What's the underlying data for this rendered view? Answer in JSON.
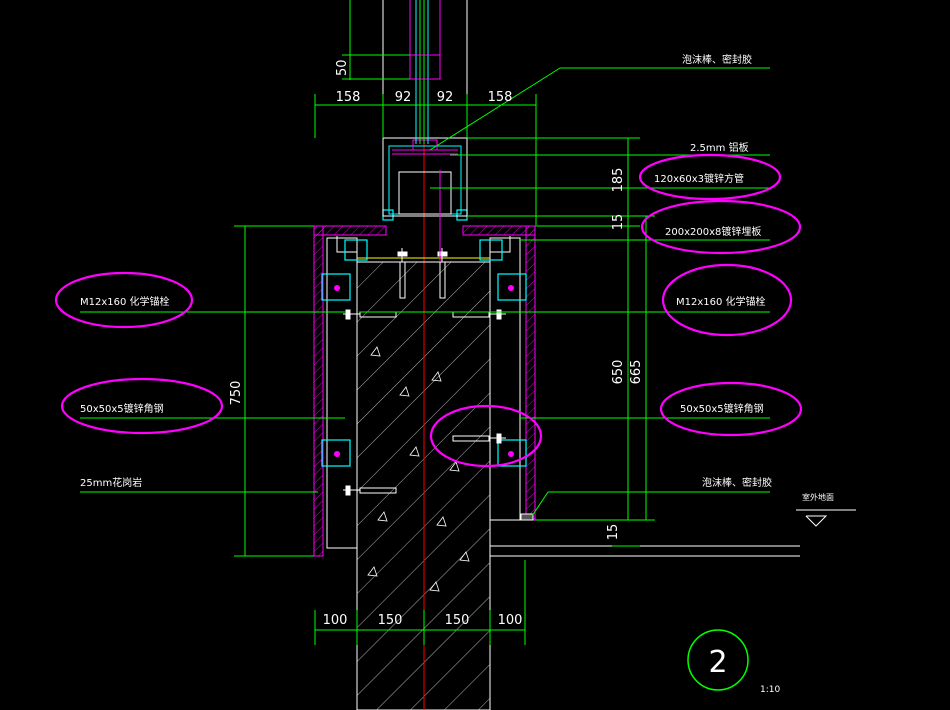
{
  "drawing": {
    "detail_number": "2",
    "scale": "1:10",
    "colors": {
      "background": "#000000",
      "dimension": "#00ff00",
      "outline": "#ffffff",
      "magenta": "#ff00ff",
      "cyan": "#00ffff",
      "yellow": "#ffff00",
      "red": "#ff0000",
      "blue": "#3a5bff"
    },
    "dimensions": {
      "top_50": "50",
      "top_158_left": "158",
      "top_92_left": "92",
      "top_92_right": "92",
      "top_158_right": "158",
      "right_185": "185",
      "right_15_top": "15",
      "right_650": "650",
      "right_665": "665",
      "right_15_bottom": "15",
      "left_750": "750",
      "bottom_100_left": "100",
      "bottom_150_left": "150",
      "bottom_150_right": "150",
      "bottom_100_right": "100"
    },
    "labels": {
      "foam_sealant_top": "泡沫棒、密封胶",
      "aluminum_plate": "2.5mm 铝板",
      "square_tube": "120x60x3镀锌方管",
      "embed_plate": "200x200x8镀锌埋板",
      "anchor_left": "M12x160  化学锚栓",
      "anchor_right": "M12x160  化学锚栓",
      "angle_left": "50x50x5镀锌角钢",
      "angle_right": "50x50x5镀锌角钢",
      "granite": "25mm花岗岩",
      "foam_sealant_bottom": "泡沫棒、密封胶",
      "outdoor_ground": "室外地面"
    }
  }
}
